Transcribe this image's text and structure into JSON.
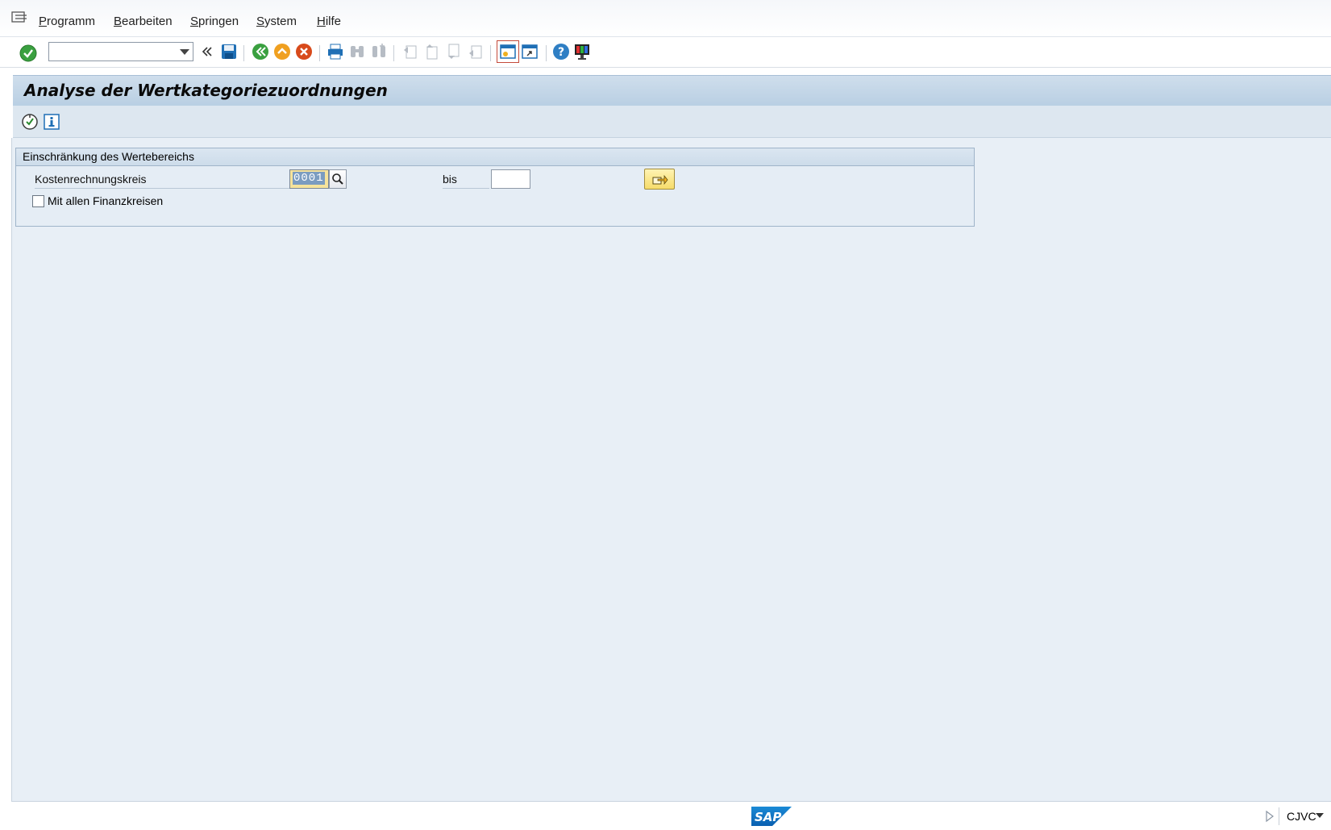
{
  "menu": {
    "items": [
      {
        "mnemonic": "P",
        "rest": "rogramm"
      },
      {
        "mnemonic": "B",
        "rest": "earbeiten"
      },
      {
        "mnemonic": "S",
        "rest": "pringen"
      },
      {
        "mnemonic": "S",
        "rest": "ystem"
      },
      {
        "mnemonic": "H",
        "rest": "ilfe"
      }
    ]
  },
  "toolbar": {
    "command_value": "",
    "icons": [
      "enter-check-icon",
      "history-back-icon",
      "save-icon",
      "back-icon",
      "exit-icon",
      "cancel-icon",
      "print-icon",
      "find-icon",
      "find-next-icon",
      "first-page-icon",
      "previous-page-icon",
      "next-page-icon",
      "last-page-icon",
      "new-session-icon",
      "create-shortcut-icon",
      "help-icon",
      "customize-layout-icon"
    ]
  },
  "title": "Analyse der Wertkategoriezuordnungen",
  "app_toolbar": {
    "icons": [
      "execute-icon",
      "info-icon"
    ]
  },
  "selection": {
    "group_title": "Einschränkung des Wertebereichs",
    "field_label": "Kostenrechnungskreis",
    "from_value": "0001",
    "to_label": "bis",
    "to_value": "",
    "checkbox_label": "Mit allen Finanzkreisen",
    "checkbox_checked": false
  },
  "status": {
    "logo_text": "SAP",
    "system": "CJVC"
  },
  "colors": {
    "accent_blue": "#1f6fb5",
    "enter_green": "#3aa040",
    "exit_orange": "#f0a020",
    "cancel_red": "#d84a1b"
  }
}
